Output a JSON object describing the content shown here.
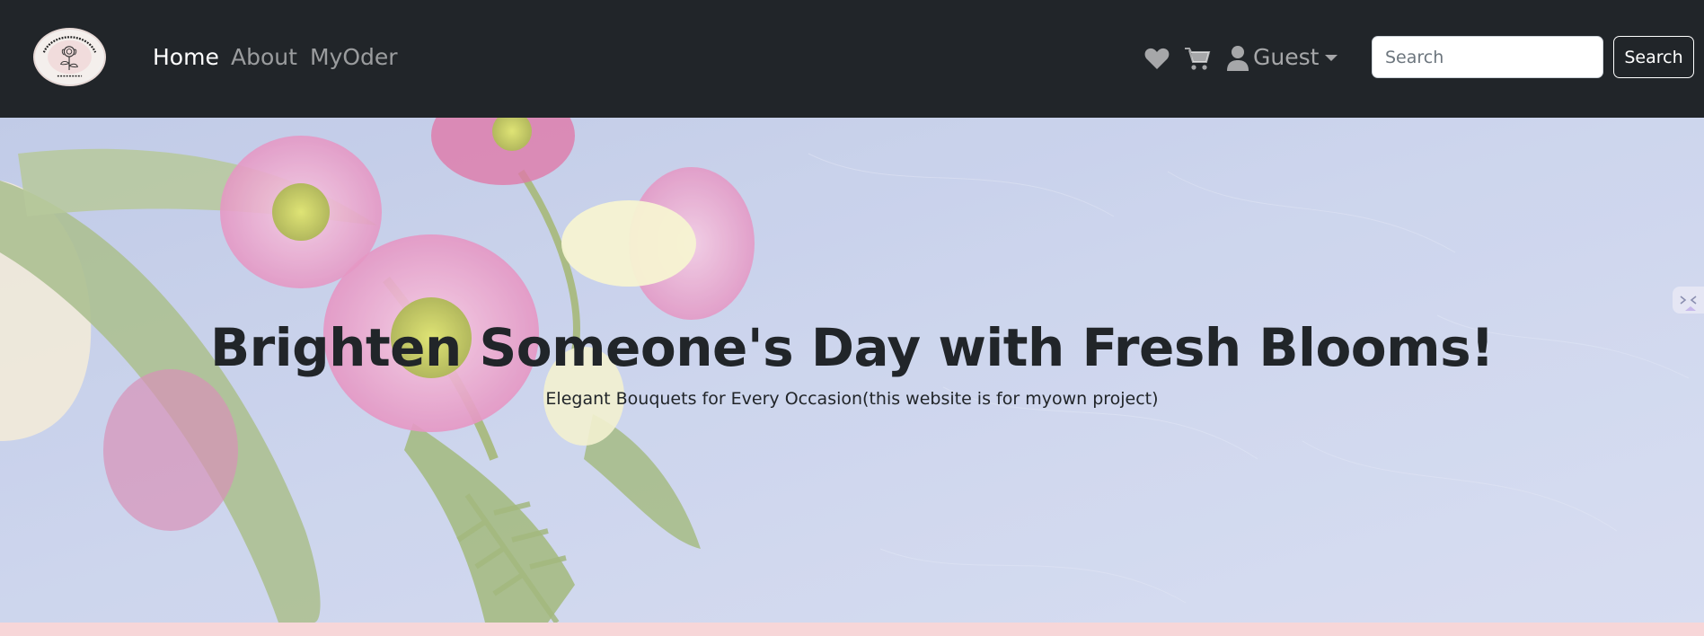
{
  "brand": {
    "logo_icon": "rose-logo-icon",
    "logo_text": "BLOOMBOUTIQUE",
    "logo_since": "SINCE 2024"
  },
  "nav": {
    "links": [
      {
        "label": "Home",
        "active": true
      },
      {
        "label": "About",
        "active": false
      },
      {
        "label": "MyOder",
        "active": false
      }
    ]
  },
  "actions": {
    "wishlist_icon": "heart-icon",
    "cart_icon": "cart-icon",
    "user_icon": "user-icon",
    "user_label": "Guest"
  },
  "search": {
    "placeholder": "Search",
    "value": "",
    "button_label": "Search"
  },
  "hero": {
    "title": "Brighten Someone's Day with Fresh Blooms!",
    "subtitle": "Elegant Bouquets for Every Occasion(this website is for myown project)"
  },
  "colors": {
    "navbar_bg": "#212529",
    "hero_bg": "#c1cbe6",
    "accent_pink": "#f7d6d8"
  }
}
